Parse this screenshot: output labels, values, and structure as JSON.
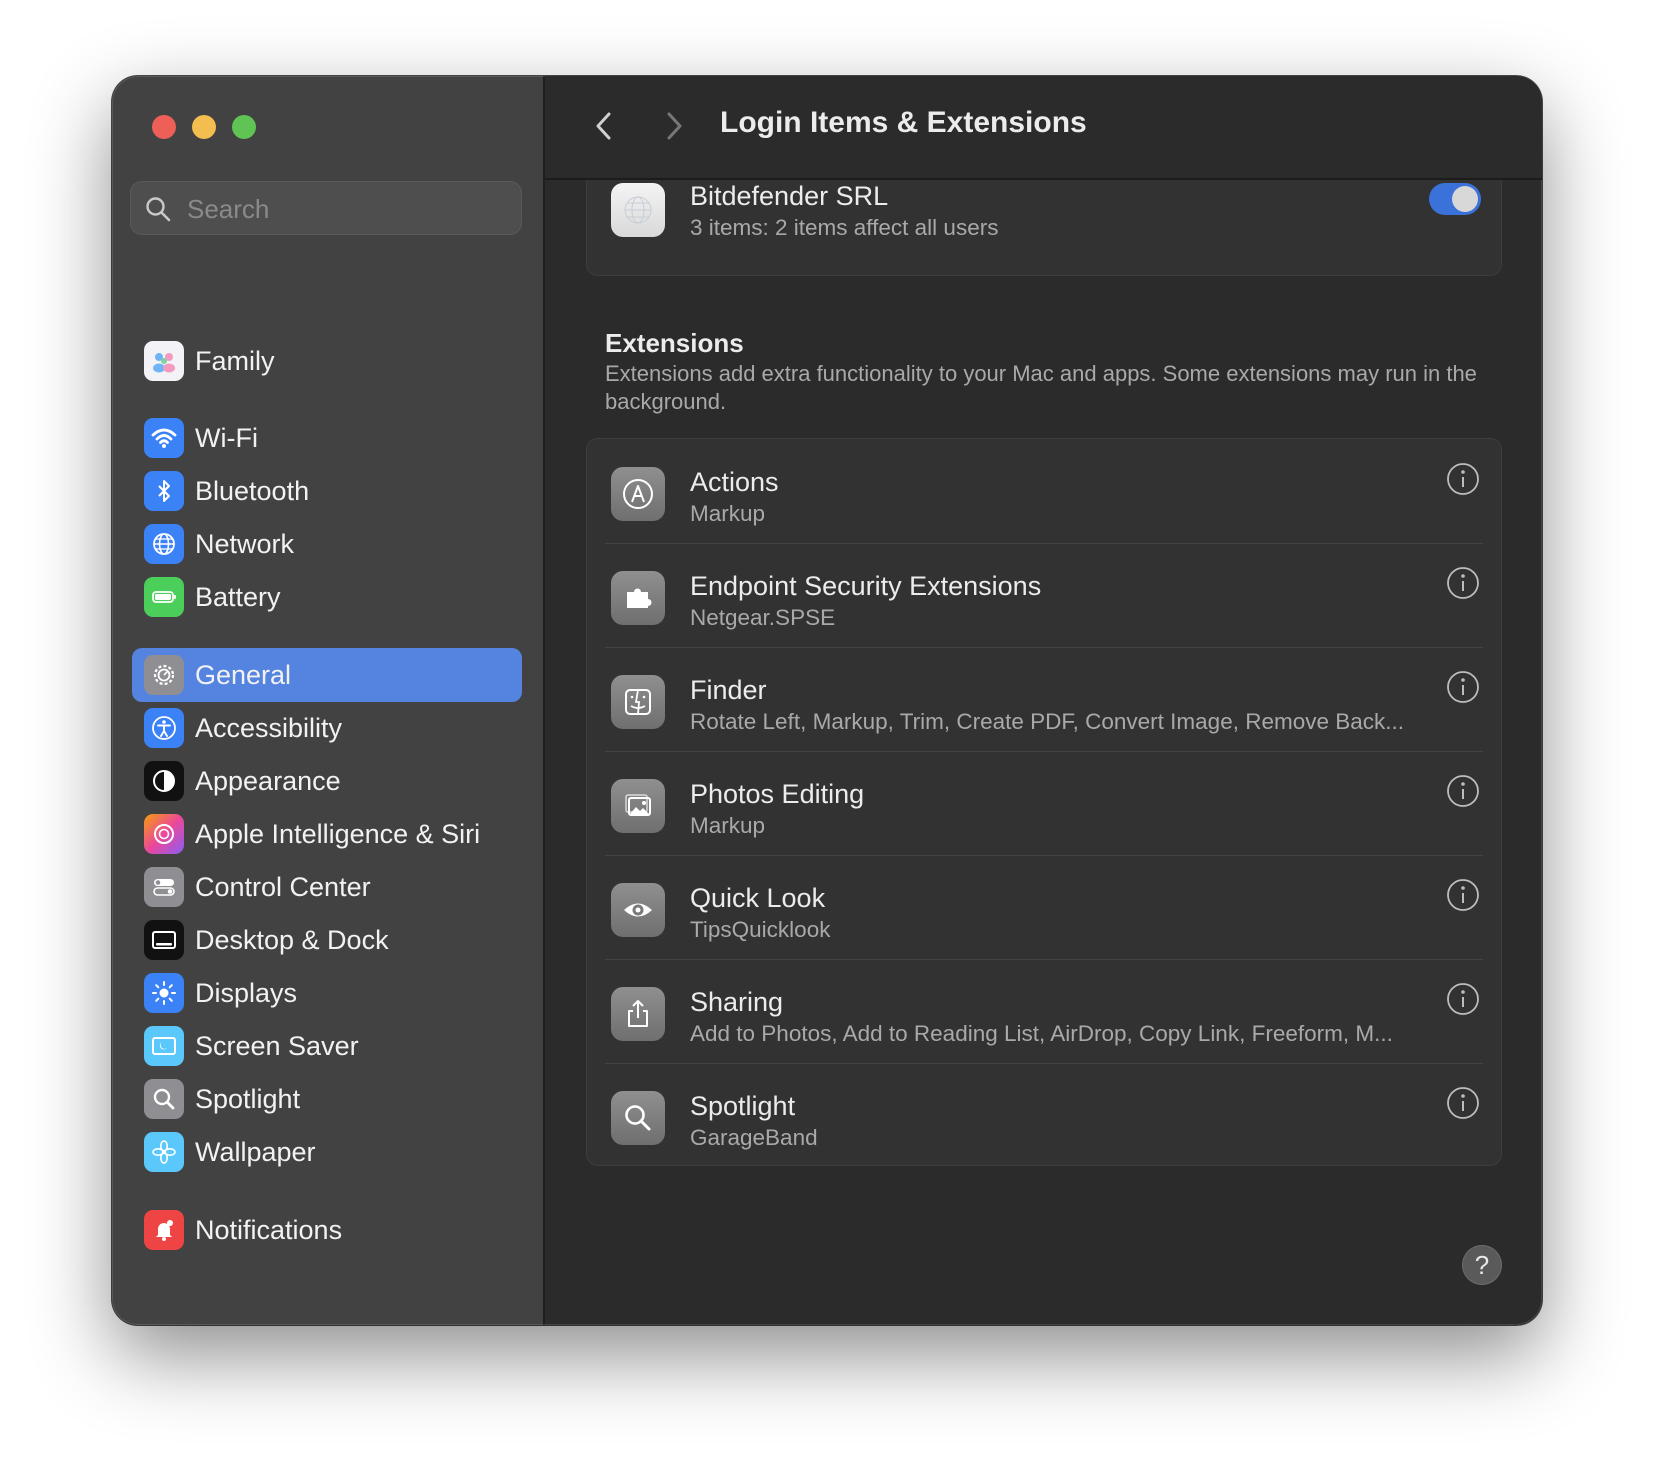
{
  "window": {
    "title": "Login Items & Extensions"
  },
  "sidebar": {
    "search_placeholder": "Search",
    "items": [
      {
        "label": "Family",
        "icon": "family-icon",
        "color": "#f0f0f0"
      },
      {
        "label": "Wi-Fi",
        "icon": "wifi-icon",
        "color": "#3b82f6"
      },
      {
        "label": "Bluetooth",
        "icon": "bluetooth-icon",
        "color": "#3b82f6"
      },
      {
        "label": "Network",
        "icon": "globe-icon",
        "color": "#3b82f6"
      },
      {
        "label": "Battery",
        "icon": "battery-icon",
        "color": "#4ccf5a"
      },
      {
        "label": "General",
        "icon": "gear-icon",
        "color": "#8e8e93",
        "selected": true
      },
      {
        "label": "Accessibility",
        "icon": "accessibility-icon",
        "color": "#3b82f6"
      },
      {
        "label": "Appearance",
        "icon": "appearance-icon",
        "color": "#111111"
      },
      {
        "label": "Apple Intelligence & Siri",
        "icon": "siri-icon",
        "color": "#e86fb0"
      },
      {
        "label": "Control Center",
        "icon": "control-center-icon",
        "color": "#8e8e93"
      },
      {
        "label": "Desktop & Dock",
        "icon": "desktop-dock-icon",
        "color": "#111111"
      },
      {
        "label": "Displays",
        "icon": "sun-icon",
        "color": "#3b82f6"
      },
      {
        "label": "Screen Saver",
        "icon": "screen-saver-icon",
        "color": "#5ac8fa"
      },
      {
        "label": "Spotlight",
        "icon": "magnifier-icon",
        "color": "#8e8e93"
      },
      {
        "label": "Wallpaper",
        "icon": "flower-icon",
        "color": "#5ac8fa"
      },
      {
        "label": "Notifications",
        "icon": "bell-icon",
        "color": "#ef4444"
      }
    ]
  },
  "login_item": {
    "title": "Bitdefender SRL",
    "subtitle": "3 items: 2 items affect all users",
    "enabled": true
  },
  "extensions": {
    "title": "Extensions",
    "description": "Extensions add extra functionality to your Mac and apps. Some extensions may run in the background.",
    "rows": [
      {
        "title": "Actions",
        "subtitle": "Markup",
        "icon": "actions-icon"
      },
      {
        "title": "Endpoint Security Extensions",
        "subtitle": "Netgear.SPSE",
        "icon": "puzzle-icon"
      },
      {
        "title": "Finder",
        "subtitle": "Rotate Left, Markup, Trim, Create PDF, Convert Image, Remove Back...",
        "icon": "finder-icon"
      },
      {
        "title": "Photos Editing",
        "subtitle": "Markup",
        "icon": "photos-icon"
      },
      {
        "title": "Quick Look",
        "subtitle": "TipsQuicklook",
        "icon": "eye-icon"
      },
      {
        "title": "Sharing",
        "subtitle": "Add to Photos, Add to Reading List, AirDrop, Copy Link, Freeform, M...",
        "icon": "share-icon"
      },
      {
        "title": "Spotlight",
        "subtitle": "GarageBand",
        "icon": "magnifier-icon"
      }
    ]
  },
  "help_label": "?",
  "colors": {
    "accent": "#5584e0",
    "toggle_on": "#3a72d9"
  }
}
